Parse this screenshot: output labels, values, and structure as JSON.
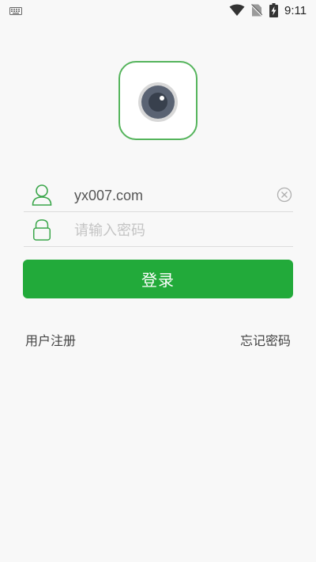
{
  "status_bar": {
    "time": "9:11",
    "icons": [
      "keyboard-icon",
      "wifi-icon",
      "no-sim-icon",
      "battery-charging-icon"
    ]
  },
  "logo": {
    "icon": "camera-lens-icon",
    "accent_color": "#55b45c"
  },
  "login_form": {
    "username": {
      "value": "yx007.com",
      "icon": "user-icon",
      "clear_icon": "clear-circle-icon"
    },
    "password": {
      "value": "",
      "placeholder": "请输入密码",
      "icon": "lock-icon"
    },
    "login_label": "登录",
    "button_color": "#22aa3a"
  },
  "links": {
    "register": "用户注册",
    "forgot_password": "忘记密码"
  }
}
